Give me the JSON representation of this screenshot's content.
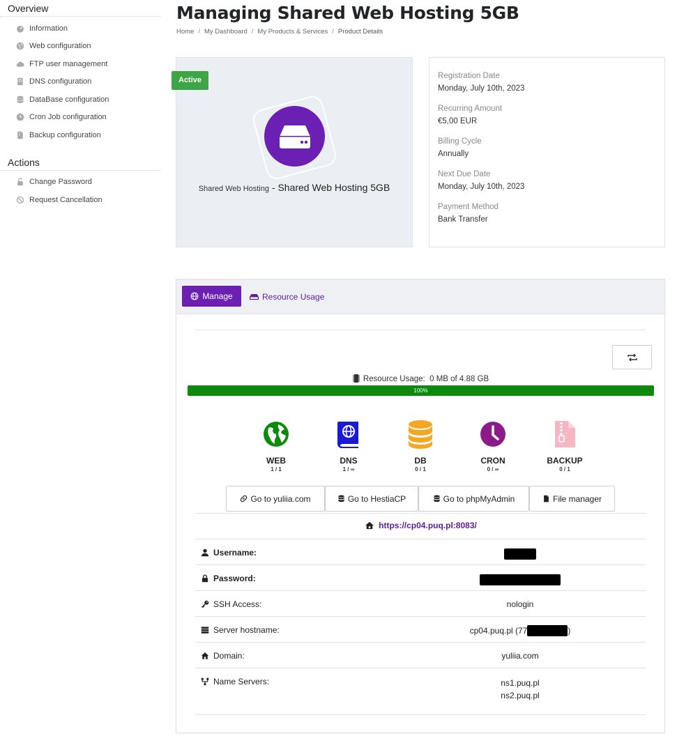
{
  "sidebar": {
    "overview_title": "Overview",
    "overview_items": [
      {
        "label": "Information",
        "icon": "gauge-icon"
      },
      {
        "label": "Web configuration",
        "icon": "globe-icon"
      },
      {
        "label": "FTP user management",
        "icon": "cloud-icon"
      },
      {
        "label": "DNS configuration",
        "icon": "book-icon"
      },
      {
        "label": "DataBase configuration",
        "icon": "database-icon"
      },
      {
        "label": "Cron Job configuration",
        "icon": "clock-icon"
      },
      {
        "label": "Backup configuration",
        "icon": "file-zip-icon"
      }
    ],
    "actions_title": "Actions",
    "action_items": [
      {
        "label": "Change Password",
        "icon": "unlock-icon"
      },
      {
        "label": "Request Cancellation",
        "icon": "ban-icon"
      }
    ]
  },
  "header": {
    "title": "Managing Shared Web Hosting 5GB",
    "breadcrumb": [
      "Home",
      "My Dashboard",
      "My Products & Services",
      "Product Details"
    ]
  },
  "product": {
    "status": "Active",
    "group": "Shared Web Hosting",
    "separator": " - ",
    "name": "Shared Web Hosting 5GB",
    "accent": "#6b1fb3"
  },
  "info": {
    "registration_label": "Registration Date",
    "registration_value": "Monday, July 10th, 2023",
    "recurring_label": "Recurring Amount",
    "recurring_value": "€5,00 EUR",
    "billing_label": "Billing Cycle",
    "billing_value": "Annually",
    "due_label": "Next Due Date",
    "due_value": "Monday, July 10th, 2023",
    "payment_label": "Payment Method",
    "payment_value": "Bank Transfer"
  },
  "panel": {
    "manage_label": "Manage",
    "resource_tab_label": "Resource Usage",
    "usage_label": "Resource Usage:",
    "usage_value": "0 MB of 4.88 GB",
    "progress_text": "100%",
    "progress_percent": 100,
    "features": [
      {
        "name": "WEB",
        "count": "1 / 1",
        "color": "#0b8a0b",
        "icon": "globe-americas-icon"
      },
      {
        "name": "DNS",
        "count": "1 / ∞",
        "color": "#1a1ad6",
        "icon": "book-atlas-icon"
      },
      {
        "name": "DB",
        "count": "0 / 1",
        "color": "#f5a623",
        "icon": "database-icon"
      },
      {
        "name": "CRON",
        "count": "0 / ∞",
        "color": "#8b1a8b",
        "icon": "clock-icon"
      },
      {
        "name": "BACKUP",
        "count": "0 / 1",
        "color": "#f7b6c4",
        "icon": "file-zipper-icon"
      }
    ],
    "links": [
      {
        "label": "Go to yuliia.com",
        "icon": "link-icon"
      },
      {
        "label": "Go to HestiaCP",
        "icon": "database-icon"
      },
      {
        "label": "Go to phpMyAdmin",
        "icon": "database-icon"
      },
      {
        "label": "File manager",
        "icon": "file-icon"
      }
    ],
    "url": "https://cp04.puq.pl:8083/",
    "details": {
      "username_label": "Username:",
      "password_label": "Password:",
      "ssh_label": "SSH Access:",
      "ssh_value": "nologin",
      "hostname_label": "Server hostname:",
      "hostname_value": "cp04.puq.pl (77",
      "hostname_suffix": ")",
      "domain_label": "Domain:",
      "domain_value": "yuliia.com",
      "ns_label": "Name Servers:",
      "ns1": "ns1.puq.pl",
      "ns2": "ns2.puq.pl"
    }
  }
}
